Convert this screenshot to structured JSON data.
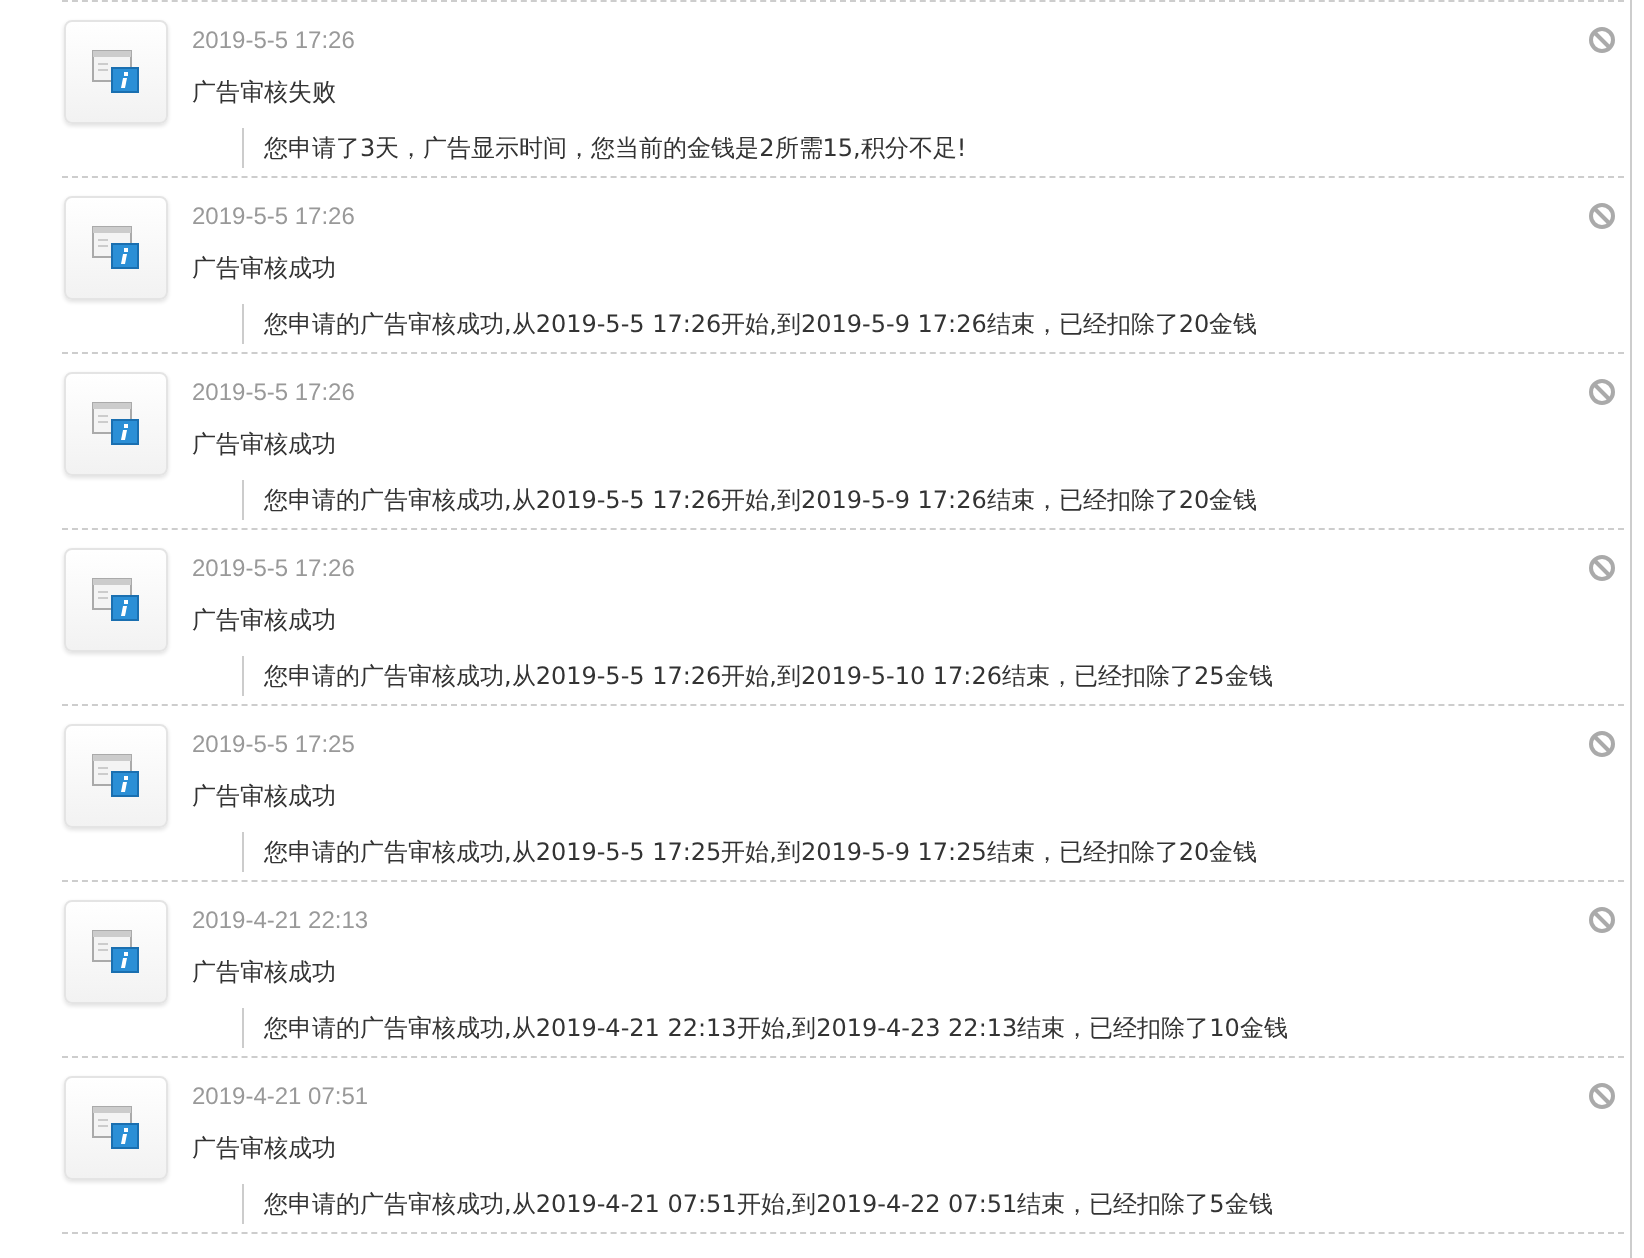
{
  "notifications": [
    {
      "time": "2019-5-5 17:26",
      "title": "广告审核失败",
      "message": "您申请了3天，广告显示时间，您当前的金钱是2所需15,积分不足!"
    },
    {
      "time": "2019-5-5 17:26",
      "title": "广告审核成功",
      "message": "您申请的广告审核成功,从2019-5-5 17:26开始,到2019-5-9 17:26结束，已经扣除了20金钱"
    },
    {
      "time": "2019-5-5 17:26",
      "title": "广告审核成功",
      "message": "您申请的广告审核成功,从2019-5-5 17:26开始,到2019-5-9 17:26结束，已经扣除了20金钱"
    },
    {
      "time": "2019-5-5 17:26",
      "title": "广告审核成功",
      "message": "您申请的广告审核成功,从2019-5-5 17:26开始,到2019-5-10 17:26结束，已经扣除了25金钱"
    },
    {
      "time": "2019-5-5 17:25",
      "title": "广告审核成功",
      "message": "您申请的广告审核成功,从2019-5-5 17:25开始,到2019-5-9 17:25结束，已经扣除了20金钱"
    },
    {
      "time": "2019-4-21 22:13",
      "title": "广告审核成功",
      "message": "您申请的广告审核成功,从2019-4-21 22:13开始,到2019-4-23 22:13结束，已经扣除了10金钱"
    },
    {
      "time": "2019-4-21 07:51",
      "title": "广告审核成功",
      "message": "您申请的广告审核成功,从2019-4-21 07:51开始,到2019-4-22 07:51结束，已经扣除了5金钱"
    }
  ]
}
